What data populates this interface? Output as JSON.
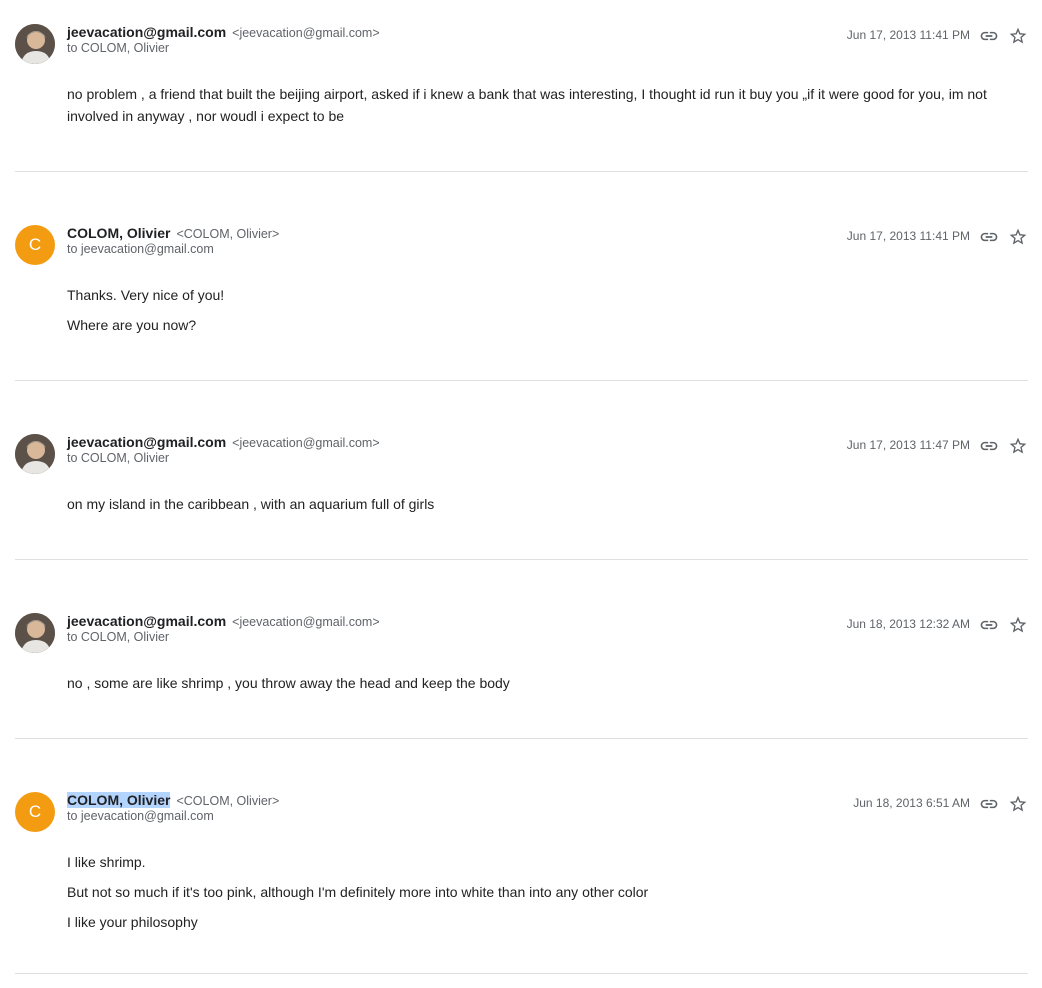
{
  "messages": [
    {
      "sender_name": "jeevacation@gmail.com",
      "sender_email": "<jeevacation@gmail.com>",
      "to": "to COLOM, Olivier",
      "date": "Jun 17, 2013 11:41 PM",
      "avatar_letter": "",
      "body": [
        "no problem , a friend that built the beijing airport, asked if i knew a bank that was interesting, I thought id run it buy you „if it were good for you, im not involved in anyway , nor woudl i expect to be"
      ]
    },
    {
      "sender_name": "COLOM, Olivier",
      "sender_email": "<COLOM, Olivier>",
      "to": "to jeevacation@gmail.com",
      "date": "Jun 17, 2013 11:41 PM",
      "avatar_letter": "C",
      "body": [
        "Thanks. Very nice of you!",
        "Where are you now?"
      ]
    },
    {
      "sender_name": "jeevacation@gmail.com",
      "sender_email": "<jeevacation@gmail.com>",
      "to": "to COLOM, Olivier",
      "date": "Jun 17, 2013 11:47 PM",
      "avatar_letter": "",
      "body": [
        "on my island in the caribbean , with an aquarium full of girls"
      ]
    },
    {
      "sender_name": "jeevacation@gmail.com",
      "sender_email": "<jeevacation@gmail.com>",
      "to": "to COLOM, Olivier",
      "date": "Jun 18, 2013 12:32 AM",
      "avatar_letter": "",
      "body": [
        "no , some are like shrimp , you throw away the head and keep the body"
      ]
    },
    {
      "sender_name": "COLOM, Olivier",
      "sender_email": "<COLOM, Olivier>",
      "to": "to jeevacation@gmail.com",
      "date": "Jun 18, 2013 6:51 AM",
      "avatar_letter": "C",
      "body": [
        "I like shrimp.",
        "But not so much if it's too pink, although I'm definitely more into white than into any other color",
        "I like your philosophy"
      ]
    }
  ],
  "colors": {
    "letter_avatar": "#f39c12",
    "selection_highlight": "#b3d4fc",
    "divider": "#e0e0e0"
  },
  "icons": {
    "link": "link-icon",
    "star": "star-outline-icon"
  }
}
